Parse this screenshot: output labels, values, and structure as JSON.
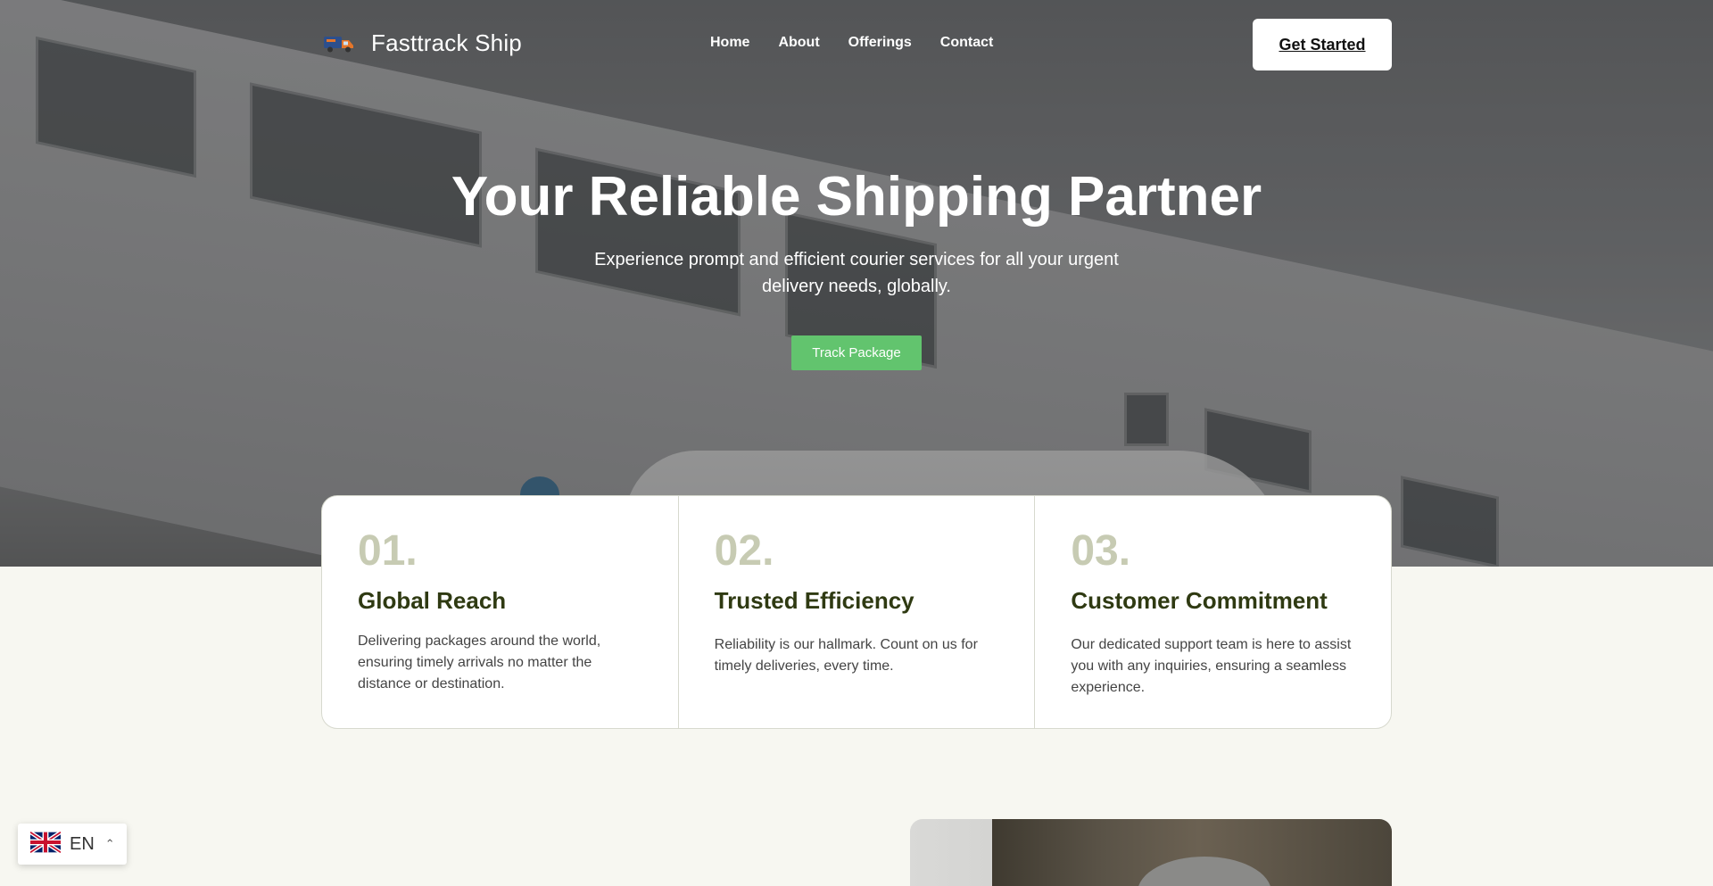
{
  "brand": {
    "name": "Fasttrack Ship"
  },
  "nav": {
    "links": [
      "Home",
      "About",
      "Offerings",
      "Contact"
    ],
    "cta_label": "Get Started"
  },
  "hero": {
    "title": "Your Reliable Shipping Partner",
    "subtitle": "Experience prompt and efficient courier services for all your urgent delivery needs, globally.",
    "button_label": "Track Package"
  },
  "features": [
    {
      "number": "01.",
      "title": "Global Reach",
      "description": "Delivering packages around the world, ensuring timely arrivals no matter the distance or destination."
    },
    {
      "number": "02.",
      "title": "Trusted Efficiency",
      "description": "Reliability is our hallmark. Count on us for timely deliveries, every time."
    },
    {
      "number": "03.",
      "title": "Customer Commitment",
      "description": "Our dedicated support team is here to assist you with any inquiries, ensuring a seamless experience."
    }
  ],
  "language": {
    "code": "EN",
    "icon": "uk-flag-icon"
  },
  "colors": {
    "accent_green": "#62c46e",
    "feature_number": "#c7cbb3",
    "feature_title": "#2f3a12",
    "page_bg": "#f7f7f1"
  }
}
